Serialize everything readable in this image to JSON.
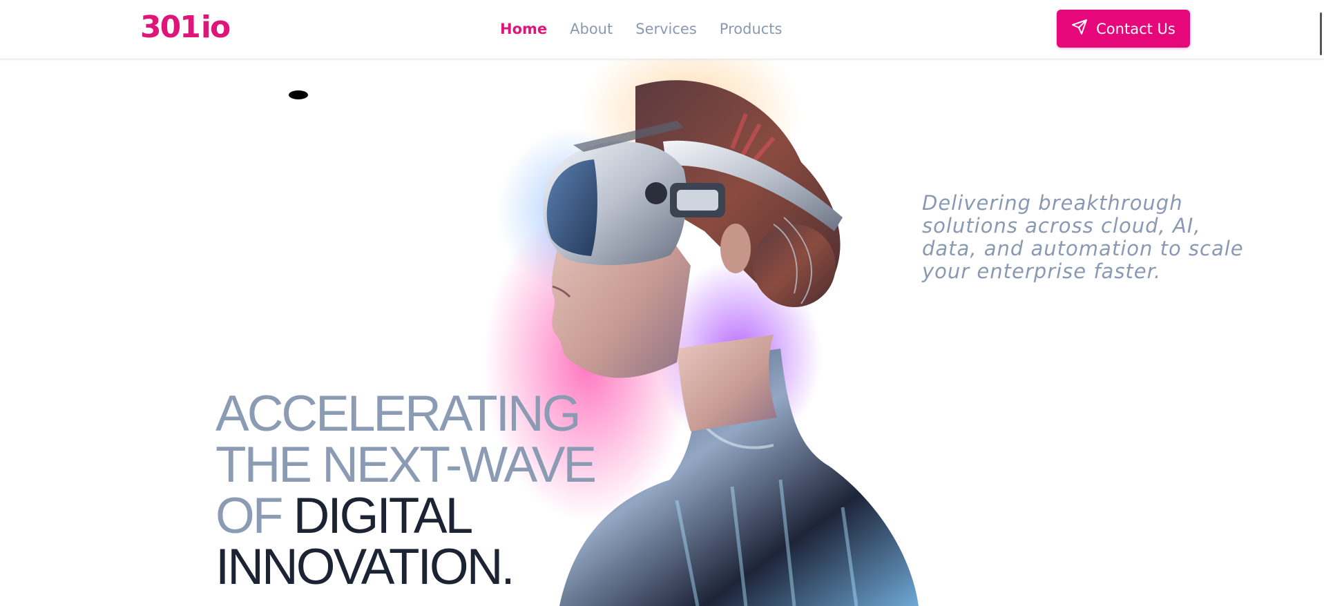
{
  "header": {
    "logo_text": "301",
    "logo_suffix": "io",
    "nav": [
      {
        "label": "Home",
        "active": true
      },
      {
        "label": "About",
        "active": false
      },
      {
        "label": "Services",
        "active": false
      },
      {
        "label": "Products",
        "active": false
      }
    ],
    "contact_label": "Contact Us",
    "contact_icon": "send-icon"
  },
  "hero": {
    "tagline": "Delivering breakthrough solutions across cloud, AI, data, and automation to scale your enterprise faster.",
    "headline_light_1": "ACCELERATING",
    "headline_light_2": "THE NEXT-WAVE",
    "headline_light_3": "OF ",
    "headline_dark_1": "DIGITAL",
    "headline_dark_2": "INNOVATION."
  },
  "colors": {
    "brand": "#e0157a",
    "muted": "#8a99b2",
    "dark": "#1c2333"
  }
}
